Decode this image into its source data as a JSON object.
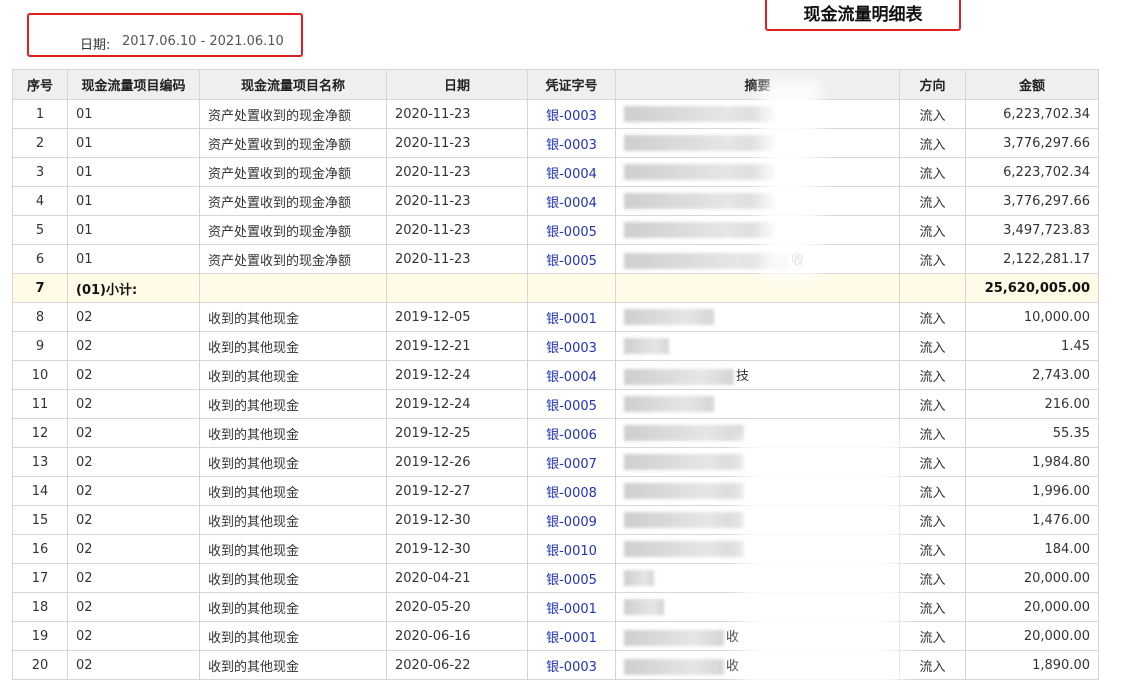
{
  "header": {
    "date_label": "日期:",
    "date_range": "2017.06.10 - 2021.06.10",
    "title": "现金流量明细表"
  },
  "table": {
    "columns": [
      "序号",
      "现金流量项目编码",
      "现金流量项目名称",
      "日期",
      "凭证字号",
      "摘要",
      "方向",
      "金额"
    ],
    "rows": [
      {
        "seq": "1",
        "code": "01",
        "name": "资产处置收到的现金净额",
        "date": "2020-11-23",
        "voucher": "银-0003",
        "summary": "",
        "direction": "流入",
        "amount": "6,223,702.34"
      },
      {
        "seq": "2",
        "code": "01",
        "name": "资产处置收到的现金净额",
        "date": "2020-11-23",
        "voucher": "银-0003",
        "summary": "",
        "direction": "流入",
        "amount": "3,776,297.66"
      },
      {
        "seq": "3",
        "code": "01",
        "name": "资产处置收到的现金净额",
        "date": "2020-11-23",
        "voucher": "银-0004",
        "summary": "",
        "direction": "流入",
        "amount": "6,223,702.34"
      },
      {
        "seq": "4",
        "code": "01",
        "name": "资产处置收到的现金净额",
        "date": "2020-11-23",
        "voucher": "银-0004",
        "summary": "",
        "direction": "流入",
        "amount": "3,776,297.66"
      },
      {
        "seq": "5",
        "code": "01",
        "name": "资产处置收到的现金净额",
        "date": "2020-11-23",
        "voucher": "银-0005",
        "summary": "",
        "direction": "流入",
        "amount": "3,497,723.83"
      },
      {
        "seq": "6",
        "code": "01",
        "name": "资产处置收到的现金净额",
        "date": "2020-11-23",
        "voucher": "银-0005",
        "summary": "收",
        "direction": "流入",
        "amount": "2,122,281.17"
      },
      {
        "seq": "7",
        "subtotal": true,
        "code": "(01)小计:",
        "name": "",
        "date": "",
        "voucher": "",
        "summary": "",
        "direction": "",
        "amount": "25,620,005.00"
      },
      {
        "seq": "8",
        "code": "02",
        "name": "收到的其他现金",
        "date": "2019-12-05",
        "voucher": "银-0001",
        "summary": "",
        "direction": "流入",
        "amount": "10,000.00"
      },
      {
        "seq": "9",
        "code": "02",
        "name": "收到的其他现金",
        "date": "2019-12-21",
        "voucher": "银-0003",
        "summary": "",
        "direction": "流入",
        "amount": "1.45"
      },
      {
        "seq": "10",
        "code": "02",
        "name": "收到的其他现金",
        "date": "2019-12-24",
        "voucher": "银-0004",
        "summary": "技",
        "direction": "流入",
        "amount": "2,743.00"
      },
      {
        "seq": "11",
        "code": "02",
        "name": "收到的其他现金",
        "date": "2019-12-24",
        "voucher": "银-0005",
        "summary": "",
        "direction": "流入",
        "amount": "216.00"
      },
      {
        "seq": "12",
        "code": "02",
        "name": "收到的其他现金",
        "date": "2019-12-25",
        "voucher": "银-0006",
        "summary": "",
        "direction": "流入",
        "amount": "55.35"
      },
      {
        "seq": "13",
        "code": "02",
        "name": "收到的其他现金",
        "date": "2019-12-26",
        "voucher": "银-0007",
        "summary": "",
        "direction": "流入",
        "amount": "1,984.80"
      },
      {
        "seq": "14",
        "code": "02",
        "name": "收到的其他现金",
        "date": "2019-12-27",
        "voucher": "银-0008",
        "summary": "",
        "direction": "流入",
        "amount": "1,996.00"
      },
      {
        "seq": "15",
        "code": "02",
        "name": "收到的其他现金",
        "date": "2019-12-30",
        "voucher": "银-0009",
        "summary": "",
        "direction": "流入",
        "amount": "1,476.00"
      },
      {
        "seq": "16",
        "code": "02",
        "name": "收到的其他现金",
        "date": "2019-12-30",
        "voucher": "银-0010",
        "summary": "",
        "direction": "流入",
        "amount": "184.00"
      },
      {
        "seq": "17",
        "code": "02",
        "name": "收到的其他现金",
        "date": "2020-04-21",
        "voucher": "银-0005",
        "summary": "",
        "direction": "流入",
        "amount": "20,000.00"
      },
      {
        "seq": "18",
        "code": "02",
        "name": "收到的其他现金",
        "date": "2020-05-20",
        "voucher": "银-0001",
        "summary": "",
        "direction": "流入",
        "amount": "20,000.00"
      },
      {
        "seq": "19",
        "code": "02",
        "name": "收到的其他现金",
        "date": "2020-06-16",
        "voucher": "银-0001",
        "summary": "收",
        "direction": "流入",
        "amount": "20,000.00"
      },
      {
        "seq": "20",
        "code": "02",
        "name": "收到的其他现金",
        "date": "2020-06-22",
        "voucher": "银-0003",
        "summary": "收",
        "direction": "流入",
        "amount": "1,890.00"
      }
    ]
  },
  "colors": {
    "highlight_border": "#e02020",
    "voucher_link": "#2233bb",
    "subtotal_bg": "#fffbe6",
    "header_bg": "#efefef"
  }
}
